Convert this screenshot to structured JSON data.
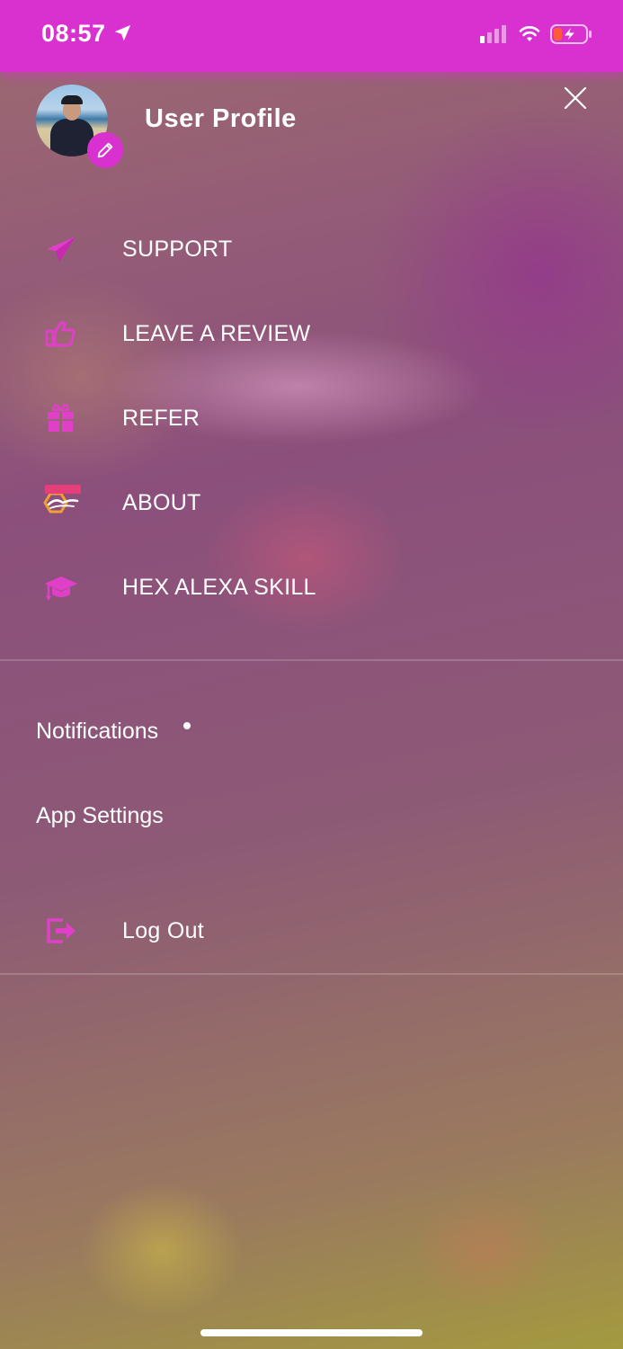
{
  "status_bar": {
    "time": "08:57",
    "icons": [
      "location-arrow-icon",
      "cellular-signal-icon",
      "wifi-icon",
      "battery-charging-icon"
    ]
  },
  "profile": {
    "title": "User Profile",
    "avatar_icon": "avatar",
    "edit_icon": "pencil-icon"
  },
  "close_icon": "close-icon",
  "menu": {
    "items": [
      {
        "label": "SUPPORT",
        "icon": "paper-plane-icon"
      },
      {
        "label": "LEAVE A REVIEW",
        "icon": "thumbs-up-icon"
      },
      {
        "label": "REFER",
        "icon": "gift-icon"
      },
      {
        "label": "ABOUT",
        "icon": "hex-toys-logo"
      },
      {
        "label": "HEX ALEXA SKILL",
        "icon": "graduation-cap-icon"
      }
    ]
  },
  "settings": {
    "notifications_label": "Notifications",
    "app_settings_label": "App Settings"
  },
  "logout": {
    "label": "Log Out",
    "icon": "logout-icon"
  },
  "colors": {
    "accent": "#d931cf",
    "icon_pink": "#e040c8",
    "text": "#ffffff"
  }
}
